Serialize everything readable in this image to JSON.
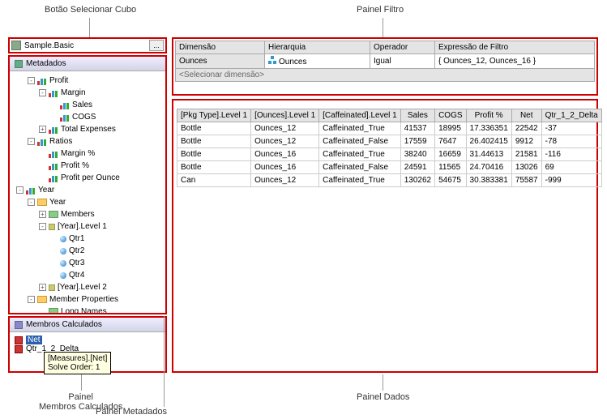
{
  "labels": {
    "top_cube": "Botão Selecionar Cubo",
    "top_filter": "Painel Filtro",
    "bottom_calc": "Painel\nMembros Calculados",
    "bottom_meta": "Painel Metadados",
    "bottom_data": "Painel Dados"
  },
  "cube_button": {
    "text": "Sample.Basic",
    "more": "..."
  },
  "metadata": {
    "header": "Metadados",
    "nodes": [
      {
        "indent": 1,
        "exp": "-",
        "icon": "bars",
        "label": "Profit"
      },
      {
        "indent": 2,
        "exp": "-",
        "icon": "bars",
        "label": "Margin"
      },
      {
        "indent": 3,
        "exp": "",
        "icon": "bars",
        "label": "Sales"
      },
      {
        "indent": 3,
        "exp": "",
        "icon": "bars",
        "label": "COGS"
      },
      {
        "indent": 2,
        "exp": "+",
        "icon": "bars",
        "label": "Total Expenses"
      },
      {
        "indent": 1,
        "exp": "-",
        "icon": "bars",
        "label": "Ratios"
      },
      {
        "indent": 2,
        "exp": "",
        "icon": "bars",
        "label": "Margin %"
      },
      {
        "indent": 2,
        "exp": "",
        "icon": "bars",
        "label": "Profit %"
      },
      {
        "indent": 2,
        "exp": "",
        "icon": "bars",
        "label": "Profit per Ounce"
      },
      {
        "indent": 0,
        "exp": "-",
        "icon": "bars",
        "label": "Year"
      },
      {
        "indent": 1,
        "exp": "-",
        "icon": "folder",
        "label": "Year"
      },
      {
        "indent": 2,
        "exp": "+",
        "icon": "member",
        "label": "Members"
      },
      {
        "indent": 2,
        "exp": "-",
        "icon": "dot",
        "label": "[Year].Level 1"
      },
      {
        "indent": 3,
        "exp": "",
        "icon": "ball",
        "label": "Qtr1"
      },
      {
        "indent": 3,
        "exp": "",
        "icon": "ball",
        "label": "Qtr2"
      },
      {
        "indent": 3,
        "exp": "",
        "icon": "ball",
        "label": "Qtr3"
      },
      {
        "indent": 3,
        "exp": "",
        "icon": "ball",
        "label": "Qtr4"
      },
      {
        "indent": 2,
        "exp": "+",
        "icon": "dot",
        "label": "[Year].Level 2"
      },
      {
        "indent": 1,
        "exp": "-",
        "icon": "folder",
        "label": "Member Properties"
      },
      {
        "indent": 2,
        "exp": "",
        "icon": "member",
        "label": "Long Names"
      }
    ]
  },
  "calc": {
    "header": "Membros Calculados",
    "items": [
      "Net",
      "Qtr_1_2_Delta"
    ],
    "tooltip": "[Measures].[Net]\nSolve Order: 1"
  },
  "filter": {
    "columns": [
      "Dimensão",
      "Hierarquia",
      "Operador",
      "Expressão de Filtro"
    ],
    "rows": [
      {
        "dim": "Ounces",
        "hier": "Ounces",
        "op": "Igual",
        "expr": "{ Ounces_12, Ounces_16 }"
      },
      {
        "dim": "<Selecionar dimensão>",
        "hier": "",
        "op": "",
        "expr": ""
      }
    ]
  },
  "data": {
    "columns": [
      "[Pkg Type].Level 1",
      "[Ounces].Level 1",
      "[Caffeinated].Level 1",
      "Sales",
      "COGS",
      "Profit %",
      "Net",
      "Qtr_1_2_Delta"
    ],
    "rows": [
      [
        "Bottle",
        "Ounces_12",
        "Caffeinated_True",
        "41537",
        "18995",
        "17.336351",
        "22542",
        "-37"
      ],
      [
        "Bottle",
        "Ounces_12",
        "Caffeinated_False",
        "17559",
        "7647",
        "26.402415",
        "9912",
        "-78"
      ],
      [
        "Bottle",
        "Ounces_16",
        "Caffeinated_True",
        "38240",
        "16659",
        "31.44613",
        "21581",
        "-116"
      ],
      [
        "Bottle",
        "Ounces_16",
        "Caffeinated_False",
        "24591",
        "11565",
        "24.70416",
        "13026",
        "69"
      ],
      [
        "Can",
        "Ounces_12",
        "Caffeinated_True",
        "130262",
        "54675",
        "30.383381",
        "75587",
        "-999"
      ]
    ]
  }
}
